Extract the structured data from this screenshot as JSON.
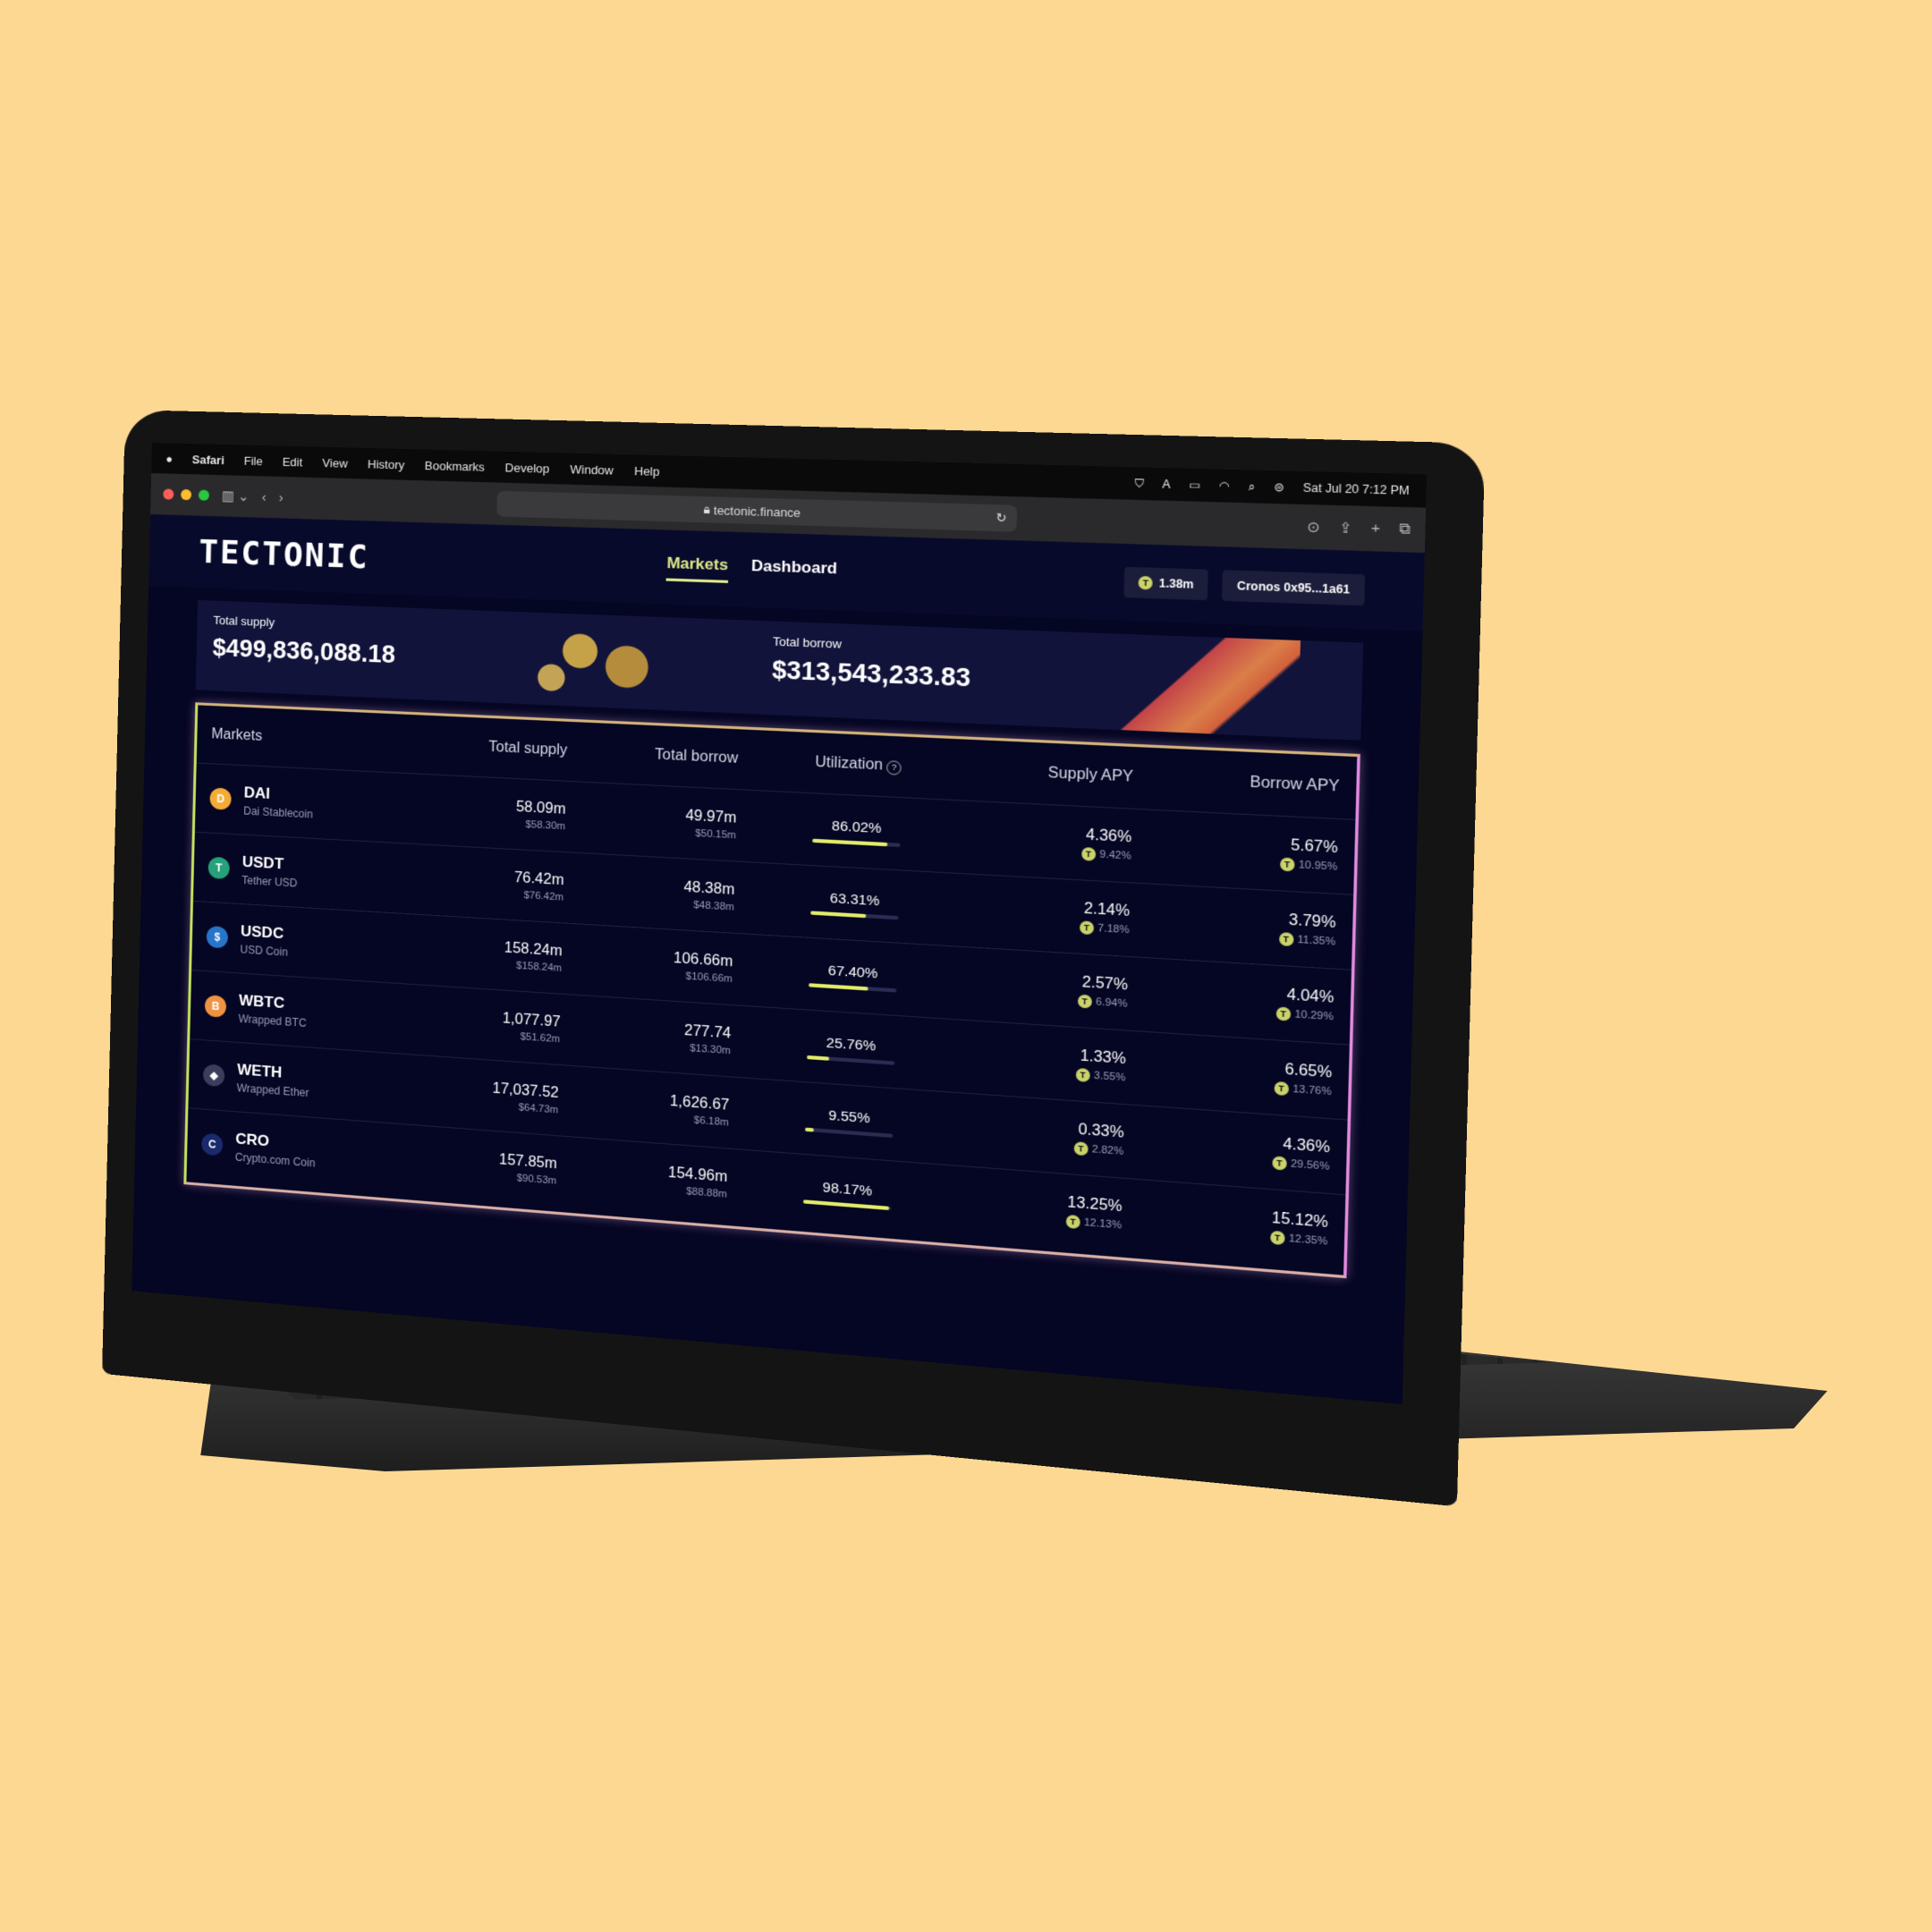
{
  "menubar": {
    "apple": "",
    "app": "Safari",
    "items": [
      "File",
      "Edit",
      "View",
      "History",
      "Bookmarks",
      "Develop",
      "Window",
      "Help"
    ],
    "datetime": "Sat Jul 20  7:12 PM"
  },
  "browser": {
    "url": "tectonic.finance",
    "colors": {
      "close": "#ff5f57",
      "minimize": "#febc2e",
      "zoom": "#28c840"
    }
  },
  "app": {
    "logo": "TECTONIC",
    "nav": [
      {
        "label": "Markets",
        "active": true
      },
      {
        "label": "Dashboard",
        "active": false
      }
    ],
    "tonic_balance": "1.38m",
    "wallet": "Cronos 0x95...1a61",
    "accent": "#dfe98a"
  },
  "summary": {
    "total_supply_label": "Total supply",
    "total_supply_value": "$499,836,088.18",
    "total_borrow_label": "Total borrow",
    "total_borrow_value": "$313,543,233.83"
  },
  "markets": {
    "headers": [
      "Markets",
      "Total supply",
      "Total borrow",
      "Utilization",
      "Supply APY",
      "Borrow APY"
    ],
    "rows": [
      {
        "symbol": "DAI",
        "name": "Dai Stablecoin",
        "icon": "dai-icon",
        "color": "#f5ac37",
        "glyph": "D",
        "supply": "58.09m",
        "supply_usd": "$58.30m",
        "borrow": "49.97m",
        "borrow_usd": "$50.15m",
        "utilization": "86.02%",
        "util_value": 86.02,
        "supply_apy": "4.36%",
        "supply_tonic": "9.42%",
        "borrow_apy": "5.67%",
        "borrow_tonic": "10.95%"
      },
      {
        "symbol": "USDT",
        "name": "Tether USD",
        "icon": "usdt-icon",
        "color": "#26a17b",
        "glyph": "T",
        "supply": "76.42m",
        "supply_usd": "$76.42m",
        "borrow": "48.38m",
        "borrow_usd": "$48.38m",
        "utilization": "63.31%",
        "util_value": 63.31,
        "supply_apy": "2.14%",
        "supply_tonic": "7.18%",
        "borrow_apy": "3.79%",
        "borrow_tonic": "11.35%"
      },
      {
        "symbol": "USDC",
        "name": "USD Coin",
        "icon": "usdc-icon",
        "color": "#2775ca",
        "glyph": "$",
        "supply": "158.24m",
        "supply_usd": "$158.24m",
        "borrow": "106.66m",
        "borrow_usd": "$106.66m",
        "utilization": "67.40%",
        "util_value": 67.4,
        "supply_apy": "2.57%",
        "supply_tonic": "6.94%",
        "borrow_apy": "4.04%",
        "borrow_tonic": "10.29%"
      },
      {
        "symbol": "WBTC",
        "name": "Wrapped BTC",
        "icon": "wbtc-icon",
        "color": "#f09242",
        "glyph": "B",
        "supply": "1,077.97",
        "supply_usd": "$51.62m",
        "borrow": "277.74",
        "borrow_usd": "$13.30m",
        "utilization": "25.76%",
        "util_value": 25.76,
        "supply_apy": "1.33%",
        "supply_tonic": "3.55%",
        "borrow_apy": "6.65%",
        "borrow_tonic": "13.76%"
      },
      {
        "symbol": "WETH",
        "name": "Wrapped Ether",
        "icon": "weth-icon",
        "color": "#3c3c5d",
        "glyph": "◆",
        "supply": "17,037.52",
        "supply_usd": "$64.73m",
        "borrow": "1,626.67",
        "borrow_usd": "$6.18m",
        "utilization": "9.55%",
        "util_value": 9.55,
        "supply_apy": "0.33%",
        "supply_tonic": "2.82%",
        "borrow_apy": "4.36%",
        "borrow_tonic": "29.56%"
      },
      {
        "symbol": "CRO",
        "name": "Crypto.com Coin",
        "icon": "cro-icon",
        "color": "#1a2a6c",
        "glyph": "C",
        "supply": "157.85m",
        "supply_usd": "$90.53m",
        "borrow": "154.96m",
        "borrow_usd": "$88.88m",
        "utilization": "98.17%",
        "util_value": 98.17,
        "supply_apy": "13.25%",
        "supply_tonic": "12.13%",
        "borrow_apy": "15.12%",
        "borrow_tonic": "12.35%"
      }
    ]
  }
}
